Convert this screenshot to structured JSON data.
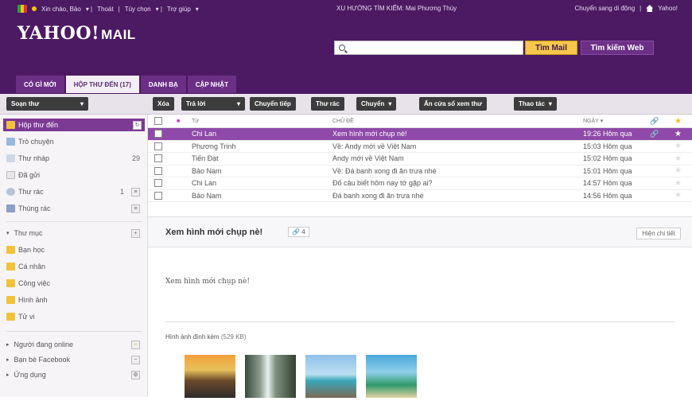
{
  "top": {
    "greeting": "Xin chào, Bảo",
    "signout": "Thoát",
    "options": "Tùy chọn",
    "help": "Trợ giúp",
    "trend": "XU HƯỚNG TÌM KIẾM: Mai Phương Thúy",
    "mobile": "Chuyển sang di động",
    "yahoo": "Yahoo!"
  },
  "brand": {
    "logo": "YAHOO!",
    "mail": "MAIL"
  },
  "search": {
    "placeholder": "",
    "mail_button": "Tìm Mail",
    "web_button": "Tìm kiếm Web"
  },
  "tabs": [
    "CÓ GÌ MỚI",
    "HỘP THƯ ĐẾN (17)",
    "DANH BẠ",
    "CẬP NHẬT"
  ],
  "toolbar": {
    "compose": "Soạn thư",
    "delete": "Xóa",
    "reply": "Trả lời",
    "forward": "Chuyển tiếp",
    "spam": "Thư rác",
    "move": "Chuyển",
    "hide": "Ẩn cửa sổ xem thư",
    "actions": "Thao tác"
  },
  "sidebar": {
    "items": [
      {
        "label": "Hộp thư đến",
        "count": ""
      },
      {
        "label": "Trò chuyện",
        "count": ""
      },
      {
        "label": "Thư nháp",
        "count": "29"
      },
      {
        "label": "Đã gửi",
        "count": ""
      },
      {
        "label": "Thư rác",
        "count": "1"
      },
      {
        "label": "Thùng rác",
        "count": ""
      }
    ],
    "folders_header": "Thư mục",
    "folders": [
      "Bạn học",
      "Cá nhân",
      "Công việc",
      "Hình ảnh",
      "Tử vi"
    ],
    "apps": [
      "Người đang online",
      "Bạn bè Facebook",
      "Ứng dụng"
    ]
  },
  "list": {
    "headers": {
      "from": "Từ",
      "subject": "CHỦ ĐỀ",
      "date": "NGÀY"
    },
    "rows": [
      {
        "from": "Chi Lan",
        "subject": "Xem hình mới chụp nè!",
        "date": "19:26 Hôm qua"
      },
      {
        "from": "Phương Trinh",
        "subject": "Về: Andy mới về Việt Nam",
        "date": "15:03 Hôm qua"
      },
      {
        "from": "Tiến Đạt",
        "subject": "Andy mới về Việt Nam",
        "date": "15:02 Hôm qua"
      },
      {
        "from": "Bảo Nam",
        "subject": "Về: Đá banh xong đi ăn trưa nhé",
        "date": "15:01 Hôm qua"
      },
      {
        "from": "Chi Lan",
        "subject": "Đố cậu biết hôm nay tớ gặp ai?",
        "date": "14:57 Hôm qua"
      },
      {
        "from": "Bảo Nam",
        "subject": "Đá banh xong đi ăn trưa nhé",
        "date": "14:56 Hôm qua"
      }
    ]
  },
  "reader": {
    "title": "Xem hình mới chụp nè!",
    "attach_count": "4",
    "show_details": "Hiện chi tiết",
    "body": "Xem hình mới chụp nè!",
    "attachments_label": "Hình ảnh đính kèm",
    "attachments_size": "(529 KB)"
  },
  "colors": {
    "brand": "#4b1a63",
    "accent": "#8f4aa9",
    "button": "#f6c74a"
  }
}
